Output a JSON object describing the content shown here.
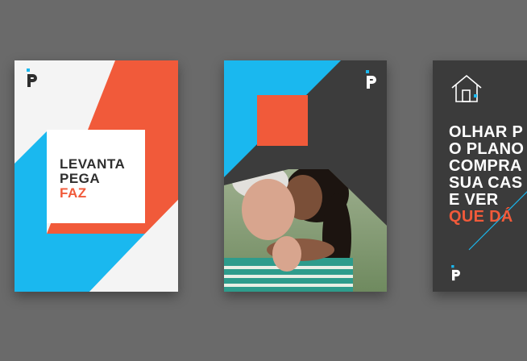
{
  "colors": {
    "background": "#6a6a6a",
    "orange": "#f15a3a",
    "blue": "#1ab8ef",
    "dark": "#3b3b3b",
    "white": "#ffffff"
  },
  "posters": [
    {
      "logo_icon": "p-logo-icon",
      "headline_lines": [
        "LEVANTA",
        "PEGA"
      ],
      "headline_accent": "FAZ"
    },
    {
      "logo_icon": "p-logo-icon",
      "photo": "grandmother-and-granddaughter-hug-photo"
    },
    {
      "top_icon": "house-icon",
      "headline_lines": [
        "OLHAR P",
        "O PLANO",
        "COMPRA",
        "SUA CAS",
        "E VER"
      ],
      "headline_accent": "QUE DÁ",
      "logo_icon": "p-logo-icon"
    }
  ]
}
